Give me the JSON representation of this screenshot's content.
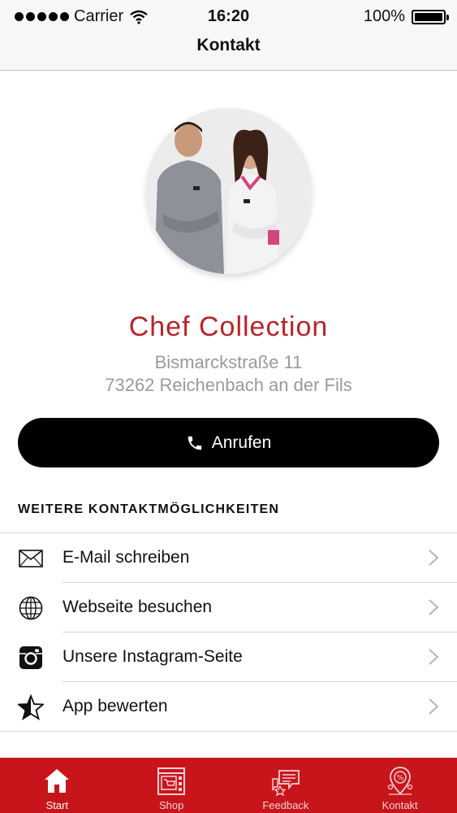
{
  "status_bar": {
    "carrier": "Carrier",
    "time": "16:20",
    "battery": "100%"
  },
  "nav": {
    "title": "Kontakt"
  },
  "profile": {
    "name": "Chef Collection",
    "address_line1": "Bismarckstraße 11",
    "address_line2": "73262 Reichenbach an der Fils"
  },
  "call_button": {
    "label": "Anrufen"
  },
  "section": {
    "title": "WEITERE KONTAKTMÖGLICHKEITEN"
  },
  "contact_options": [
    {
      "label": "E-Mail schreiben",
      "icon": "envelope-icon"
    },
    {
      "label": "Webseite besuchen",
      "icon": "globe-icon"
    },
    {
      "label": "Unsere Instagram-Seite",
      "icon": "instagram-icon"
    },
    {
      "label": "App bewerten",
      "icon": "star-icon"
    }
  ],
  "tab_bar": {
    "items": [
      {
        "label": "Start",
        "icon": "home-icon"
      },
      {
        "label": "Shop",
        "icon": "shop-icon"
      },
      {
        "label": "Feedback",
        "icon": "feedback-icon"
      },
      {
        "label": "Kontakt",
        "icon": "location-pin-icon"
      }
    ]
  },
  "colors": {
    "brand_red": "#c8151b",
    "name_red": "#b82428",
    "address_gray": "#9a9a9a",
    "button_black": "#000000"
  }
}
